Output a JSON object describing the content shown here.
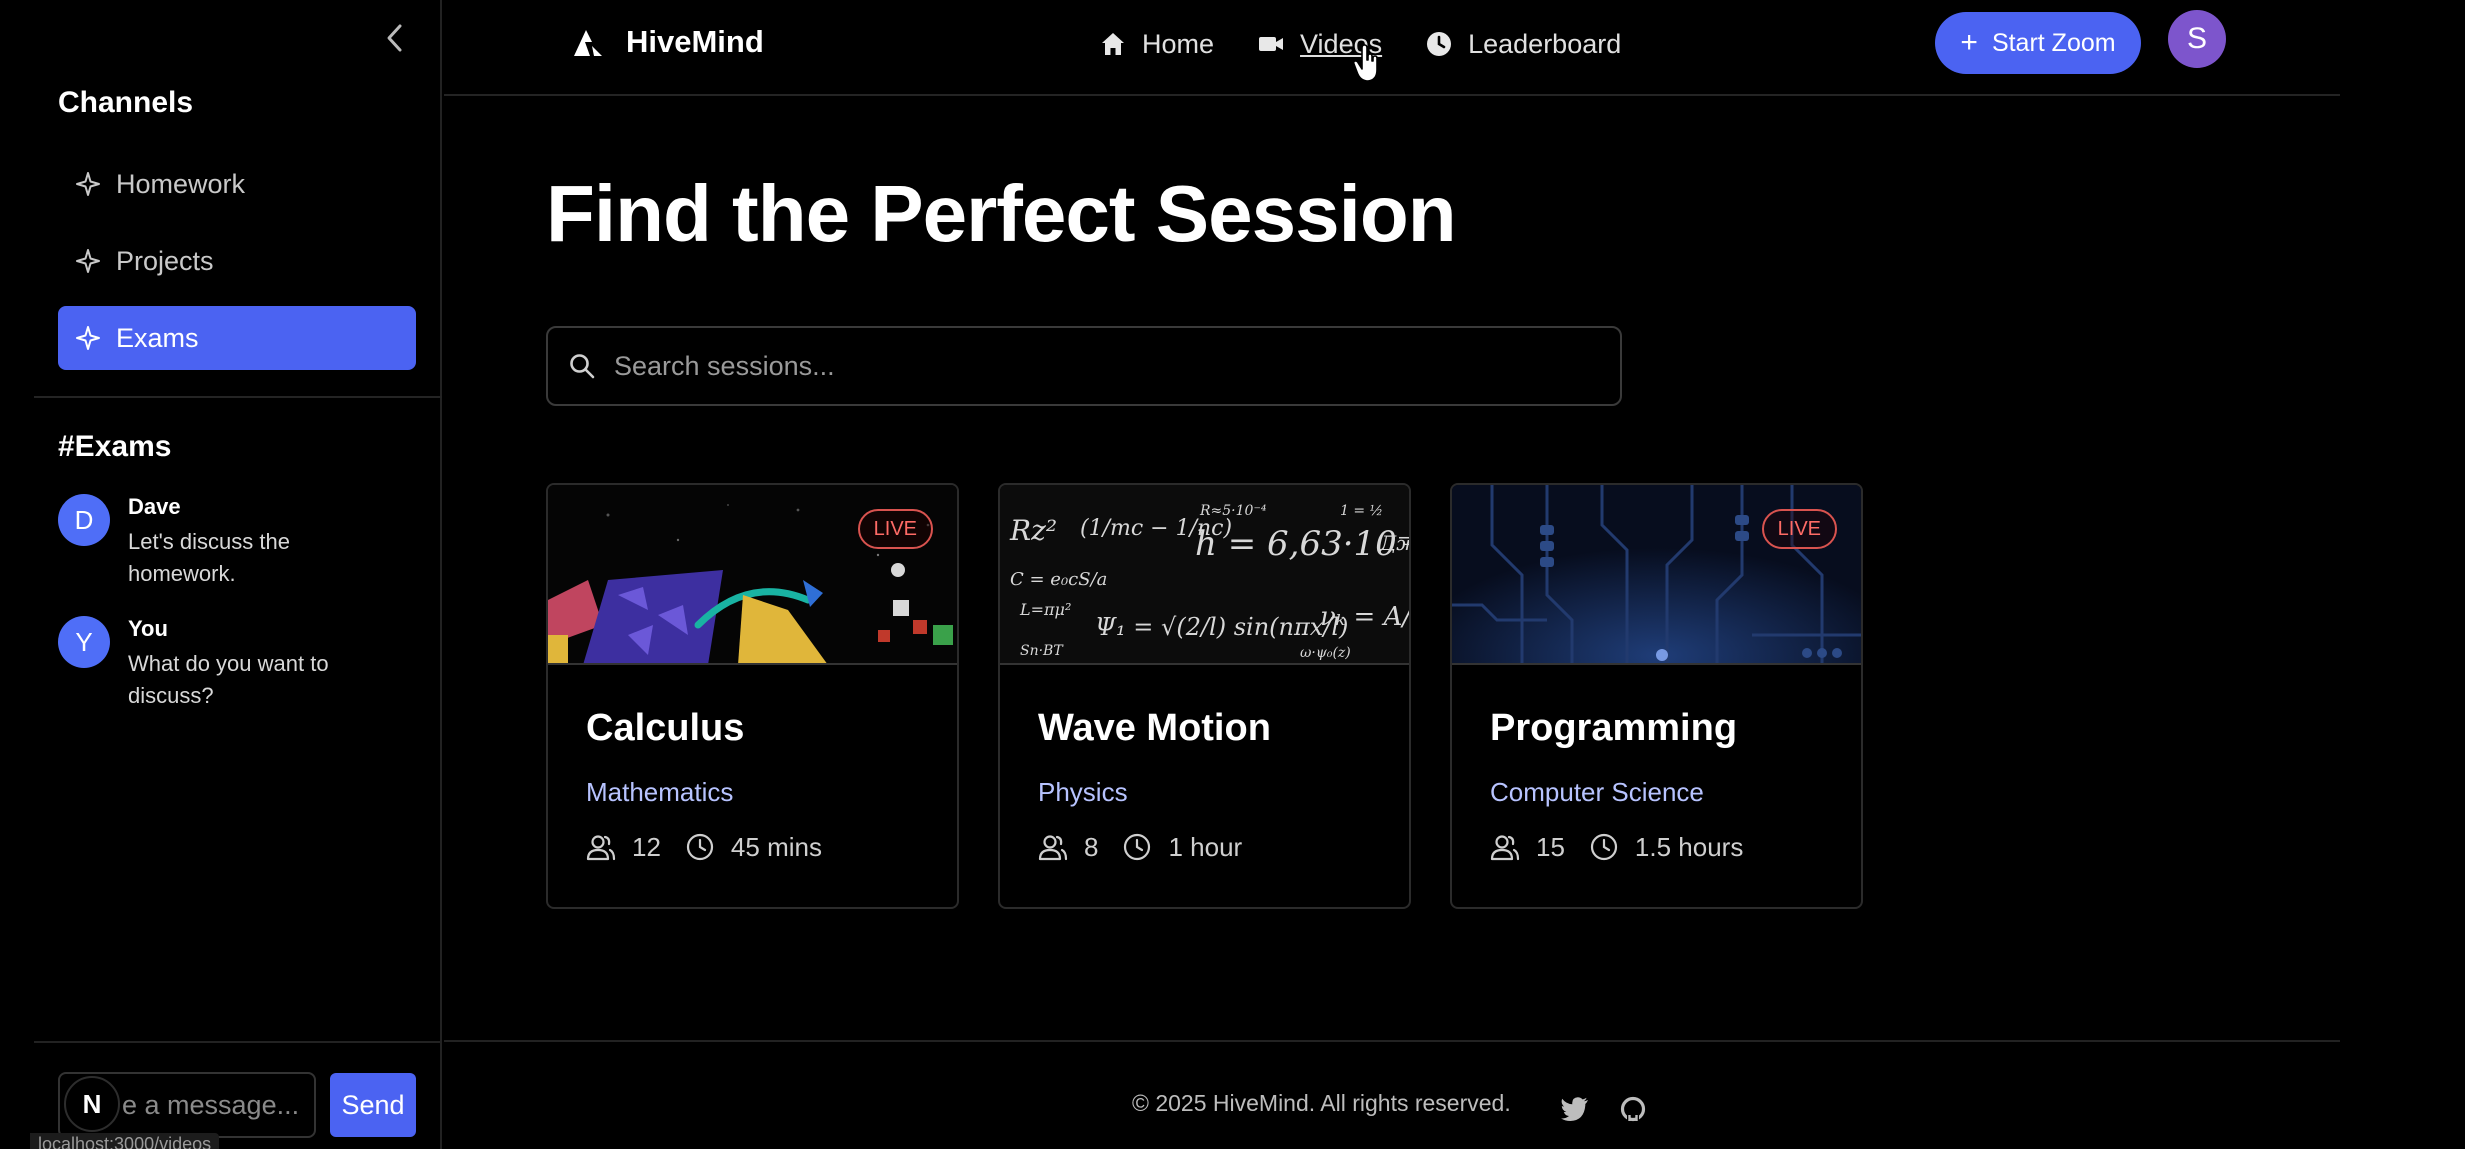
{
  "sidebar": {
    "heading": "Channels",
    "channels": [
      {
        "label": "Homework",
        "active": false
      },
      {
        "label": "Projects",
        "active": false
      },
      {
        "label": "Exams",
        "active": true
      }
    ],
    "chat_heading": "#Exams",
    "messages": [
      {
        "initial": "D",
        "name": "Dave",
        "text": "Let's discuss the homework."
      },
      {
        "initial": "Y",
        "name": "You",
        "text": "What do you want to discuss?"
      }
    ],
    "input_value": "e a message...",
    "input_badge": "N",
    "send_label": "Send",
    "status_url": "localhost:3000/videos"
  },
  "nav": {
    "brand": "HiveMind",
    "links": [
      {
        "label": "Home",
        "icon": "home-icon"
      },
      {
        "label": "Videos",
        "icon": "video-icon"
      },
      {
        "label": "Leaderboard",
        "icon": "clock-icon"
      }
    ],
    "start_zoom_label": "Start Zoom",
    "user_initial": "S"
  },
  "main": {
    "title": "Find the Perfect Session",
    "search_placeholder": "Search sessions...",
    "sessions": [
      {
        "title": "Calculus",
        "subject": "Mathematics",
        "participants": "12",
        "duration": "45 mins",
        "live": true,
        "badge": "LIVE"
      },
      {
        "title": "Wave Motion",
        "subject": "Physics",
        "participants": "8",
        "duration": "1 hour",
        "live": false,
        "badge": ""
      },
      {
        "title": "Programming",
        "subject": "Computer Science",
        "participants": "15",
        "duration": "1.5 hours",
        "live": true,
        "badge": "LIVE"
      }
    ]
  },
  "footer": {
    "copyright": "© 2025 HiveMind. All rights reserved."
  },
  "colors": {
    "accent": "#4b63f2",
    "avatar_purple": "#7d55cc",
    "live_red": "#ff6b66",
    "subject_blue": "#b7c3ff"
  }
}
